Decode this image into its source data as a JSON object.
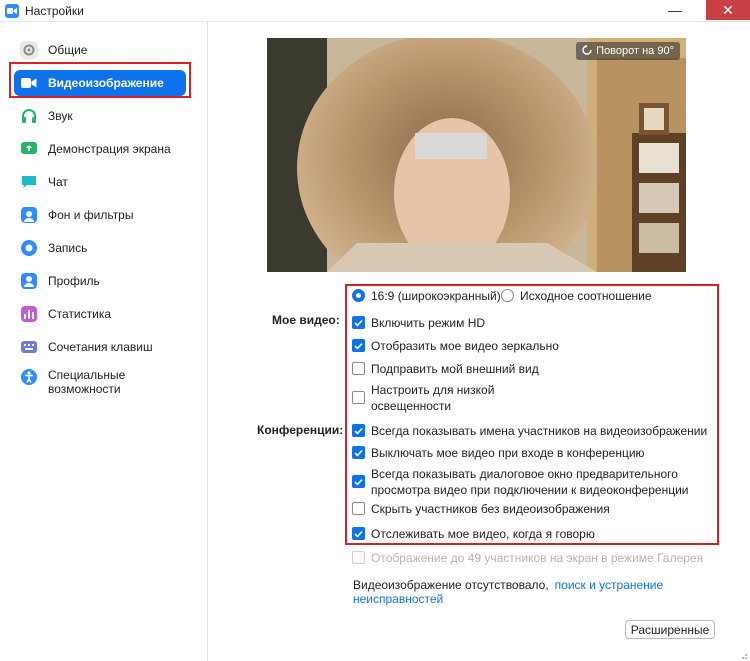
{
  "window": {
    "title": "Настройки",
    "minimize_glyph": "—",
    "close_glyph": "✕"
  },
  "sidebar": {
    "items": [
      {
        "label": "Общие",
        "icon": "gear-icon",
        "color": "#8a8a8a"
      },
      {
        "label": "Видеоизображение",
        "icon": "video-camera-icon",
        "color": "#ffffff",
        "active": true
      },
      {
        "label": "Звук",
        "icon": "headphones-icon",
        "color": "#24b36b"
      },
      {
        "label": "Демонстрация экрана",
        "icon": "share-screen-icon",
        "color": "#24b36b"
      },
      {
        "label": "Чат",
        "icon": "chat-icon",
        "color": "#1fb8c8"
      },
      {
        "label": "Фон и фильтры",
        "icon": "background-icon",
        "color": "#2d8cff"
      },
      {
        "label": "Запись",
        "icon": "record-icon",
        "color": "#2d8cff"
      },
      {
        "label": "Профиль",
        "icon": "profile-icon",
        "color": "#2d8cff"
      },
      {
        "label": "Статистика",
        "icon": "statistics-icon",
        "color": "#c35bd6"
      },
      {
        "label": "Сочетания клавиш",
        "icon": "keyboard-icon",
        "color": "#6e7bd9"
      },
      {
        "label": "Специальные возможности",
        "icon": "accessibility-icon",
        "color": "#2d8cff"
      }
    ]
  },
  "preview": {
    "rotate_label": "Поворот на 90°"
  },
  "my_video": {
    "label": "Мое видео:",
    "aspect": {
      "widescreen": {
        "label": "16:9 (широкоэкранный)",
        "selected": true
      },
      "original": {
        "label": "Исходное соотношение",
        "selected": false
      }
    },
    "options": [
      {
        "label": "Включить режим HD",
        "checked": true
      },
      {
        "label": "Отобразить мое видео зеркально",
        "checked": true
      },
      {
        "label": "Подправить мой внешний вид",
        "checked": false
      },
      {
        "label": "Настроить для низкой освещенности",
        "checked": false
      }
    ]
  },
  "meetings": {
    "label": "Конференции:",
    "options": [
      {
        "label": "Всегда показывать имена участников на видеоизображении",
        "checked": true
      },
      {
        "label": "Выключать мое видео при входе в конференцию",
        "checked": true
      },
      {
        "label": "Всегда показывать диалоговое окно предварительного просмотра видео при подключении к видеоконференции",
        "checked": true
      },
      {
        "label": "Скрыть участников без видеоизображения",
        "checked": false
      },
      {
        "label": "Отслеживать мое видео, когда я говорю",
        "checked": true
      }
    ],
    "disabled_option": {
      "label": "Отображение до 49 участников на экран в режиме Галерея",
      "checked": false
    }
  },
  "footer": {
    "missing_text": "Видеоизображение отсутствовало,",
    "troubleshoot_link": "поиск и устранение неисправностей",
    "advanced_button": "Расширенные"
  },
  "colors": {
    "accent": "#0e72ed",
    "highlight_frame": "#d8202a",
    "close_button": "#c74043"
  }
}
